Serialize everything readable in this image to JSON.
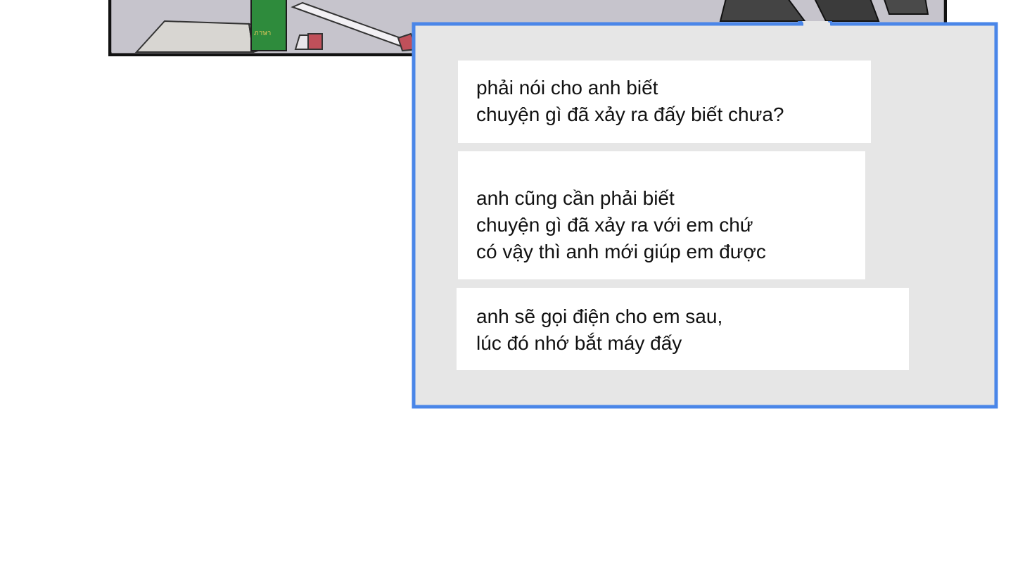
{
  "captions": [
    {
      "lines": [
        "phải nói cho anh biết",
        "chuyện gì đã xảy ra đấy biết chưa?"
      ]
    },
    {
      "lines": [
        "anh cũng cần phải biết",
        "chuyện gì đã xảy ra với em chứ",
        "có vậy thì anh mới giúp em được"
      ]
    },
    {
      "lines": [
        "anh sẽ gọi điện cho em sau,",
        "lúc đó nhớ bắt máy đấy"
      ]
    }
  ],
  "colors": {
    "bubble_border": "#4a86e8",
    "bubble_fill": "#e6e6e6",
    "caption_bg": "#ffffff",
    "panel_bg": "#c9c6cf",
    "book_green": "#2e8b3c"
  }
}
